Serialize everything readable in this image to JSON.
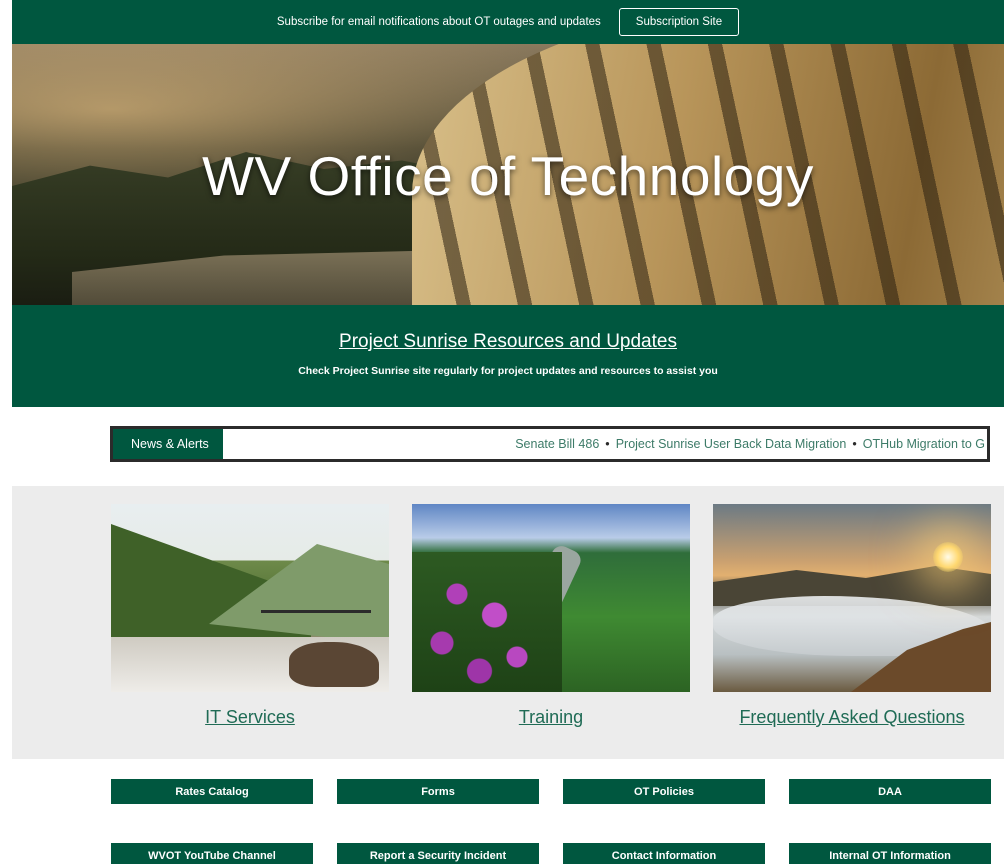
{
  "topbar": {
    "message": "Subscribe for email notifications about OT outages and updates",
    "button_label": "Subscription Site"
  },
  "hero": {
    "title": "WV Office of Technology"
  },
  "sunrise": {
    "link_text": "Project Sunrise Resources and Updates",
    "description": "Check Project Sunrise site regularly for project updates and resources to assist you"
  },
  "news": {
    "label": "News & Alerts",
    "items": [
      "Senate Bill 486",
      "Project Sunrise User Back Data Migration",
      "OTHub Migration to G"
    ]
  },
  "cards": [
    {
      "caption": "IT Services"
    },
    {
      "caption": "Training"
    },
    {
      "caption": "Frequently Asked Questions"
    }
  ],
  "buttons": {
    "row1": [
      "Rates Catalog",
      "Forms",
      "OT Policies",
      "DAA"
    ],
    "row2": [
      "WVOT YouTube Channel",
      "Report a Security Incident",
      "Contact Information",
      "Internal OT Information"
    ]
  },
  "colors": {
    "brand_green": "#00573f",
    "link_green": "#1f6b55",
    "card_band": "#ececec"
  }
}
